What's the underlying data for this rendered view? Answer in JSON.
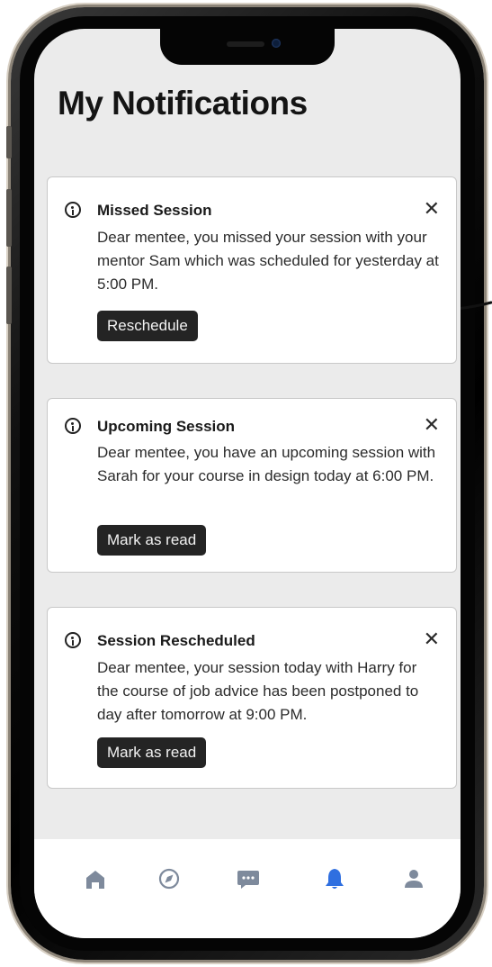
{
  "page": {
    "title": "My Notifications"
  },
  "notifications": [
    {
      "icon": "info-icon",
      "title": "Missed Session",
      "body": "Dear mentee, you missed your session with your mentor Sam which was scheduled for yesterday at 5:00 PM.",
      "action_label": "Reschedule",
      "close_glyph": "✕"
    },
    {
      "icon": "info-icon",
      "title": "Upcoming Session",
      "body": "Dear mentee, you have an upcoming session with Sarah for your course in design today at 6:00 PM.",
      "action_label": "Mark as read",
      "close_glyph": "✕"
    },
    {
      "icon": "info-icon",
      "title": "Session Rescheduled",
      "body": "Dear mentee, your session today with Harry for the course of job advice has been postponed to day after tomorrow at 9:00 PM.",
      "action_label": "Mark as read",
      "close_glyph": "✕"
    }
  ],
  "tabbar": {
    "items": [
      {
        "icon": "home-icon",
        "active": false
      },
      {
        "icon": "compass-icon",
        "active": false
      },
      {
        "icon": "chat-icon",
        "active": false
      },
      {
        "icon": "bell-icon",
        "active": true
      },
      {
        "icon": "profile-icon",
        "active": false
      }
    ],
    "active_color": "#2f6fe0",
    "inactive_color": "#7e8a9c"
  },
  "colors": {
    "screen_background": "#ebebeb",
    "card_background": "#ffffff",
    "button_background": "#242424",
    "button_text": "#f2f2f2"
  }
}
